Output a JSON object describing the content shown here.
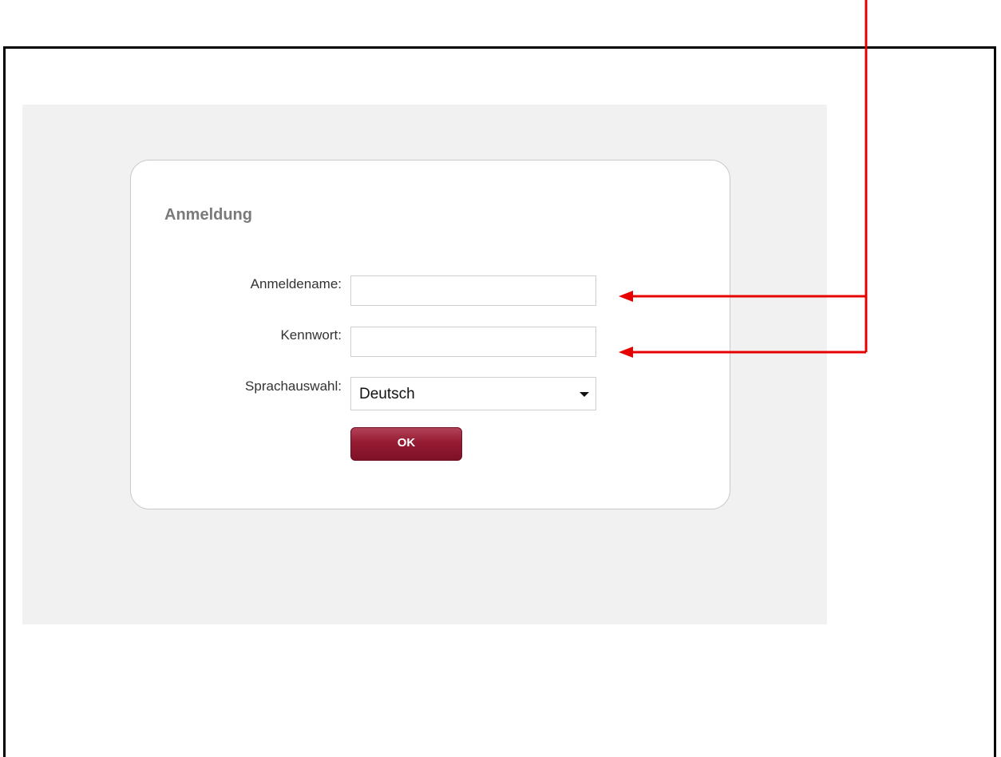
{
  "login": {
    "title": "Anmeldung",
    "username_label": "Anmeldename:",
    "username_value": "",
    "password_label": "Kennwort:",
    "password_value": "",
    "language_label": "Sprachauswahl:",
    "language_selected": "Deutsch",
    "ok_label": "OK"
  },
  "colors": {
    "annotation": "#e60000",
    "button": "#951b32",
    "panel_background": "#f1f1f1"
  }
}
